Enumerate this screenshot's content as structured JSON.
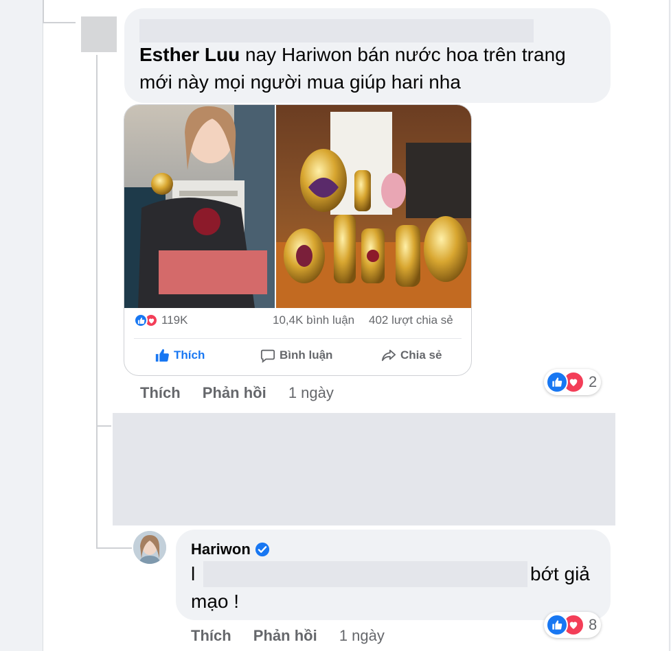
{
  "comment1": {
    "author": "Esther Luu",
    "text": "nay Hariwon bán nước hoa trên trang mới này mọi người mua giúp hari nha",
    "reactions_count": "2",
    "actions": {
      "like": "Thích",
      "reply": "Phản hồi",
      "time": "1 ngày"
    }
  },
  "shared_post": {
    "reactions_count": "119K",
    "comments_count": "10,4K bình luận",
    "shares_count": "402 lượt chia sẻ",
    "like_button": "Thích",
    "comment_button": "Bình luận",
    "share_button": "Chia sẻ",
    "like_color": "#1877f2"
  },
  "comment2": {
    "author": "Hariwon",
    "verified": true,
    "text_start": "l",
    "text_end": "bớt giả",
    "text_line2": "mạo !",
    "reactions_count": "8",
    "actions": {
      "like": "Thích",
      "reply": "Phản hồi",
      "time": "1 ngày"
    }
  },
  "icons": [
    "like-icon",
    "love-icon",
    "speech-bubble-icon",
    "share-arrow-icon",
    "verified-badge-icon"
  ],
  "colors": {
    "like": "#1877f2",
    "love": "#f33e58",
    "bubble": "#f0f2f5",
    "redaction": "#e4e6eb"
  }
}
